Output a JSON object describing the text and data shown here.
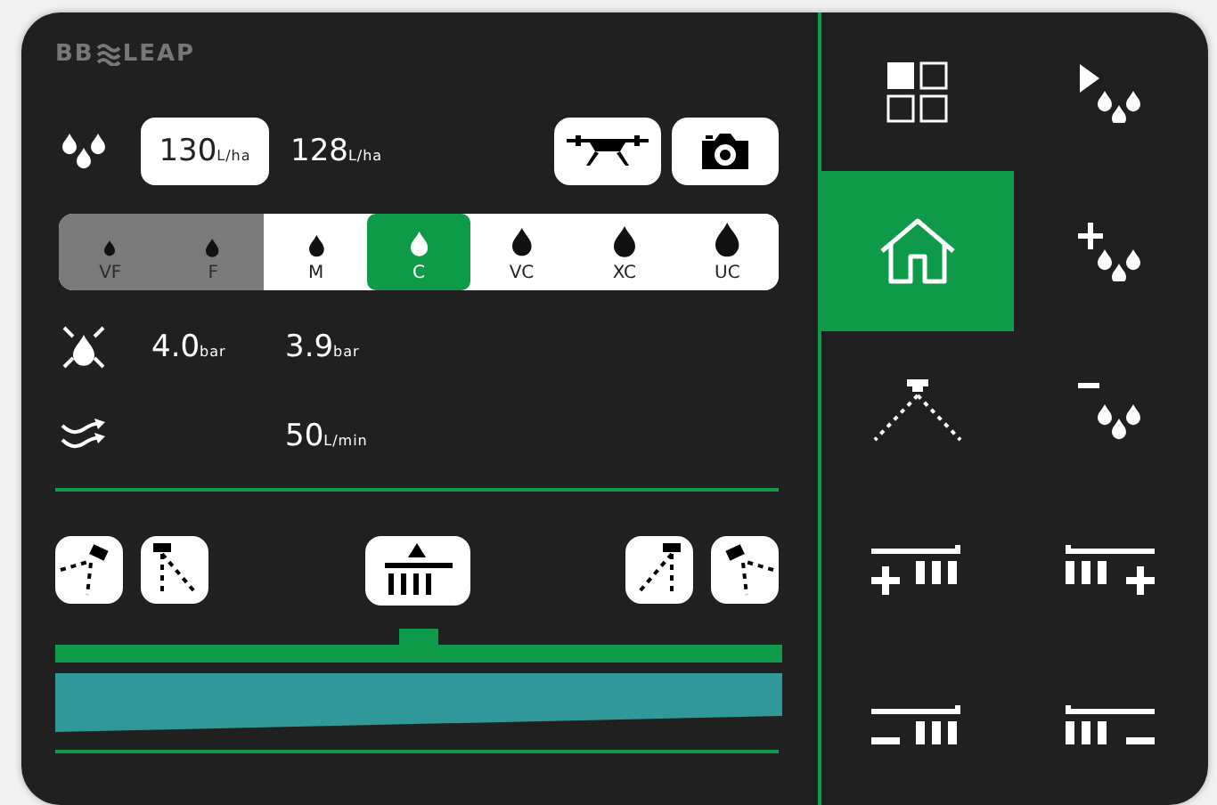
{
  "logo": {
    "left": "BB",
    "right": "LEAP"
  },
  "rate": {
    "set": "130",
    "set_unit": "L/ha",
    "actual": "128",
    "actual_unit": "L/ha"
  },
  "droplets": [
    {
      "label": "VF",
      "disabled": true,
      "selected": false
    },
    {
      "label": "F",
      "disabled": true,
      "selected": false
    },
    {
      "label": "M",
      "disabled": false,
      "selected": false
    },
    {
      "label": "C",
      "disabled": false,
      "selected": true
    },
    {
      "label": "VC",
      "disabled": false,
      "selected": false
    },
    {
      "label": "XC",
      "disabled": false,
      "selected": false
    },
    {
      "label": "UC",
      "disabled": false,
      "selected": false
    }
  ],
  "pressure": {
    "set": "4.0",
    "set_unit": "bar",
    "actual": "3.9",
    "actual_unit": "bar"
  },
  "flow": {
    "value": "50",
    "unit": "L/min"
  },
  "sections": [
    {
      "kind": "tilt-left"
    },
    {
      "kind": "raise-left"
    },
    {
      "kind": "boom"
    },
    {
      "kind": "raise-right"
    },
    {
      "kind": "tilt-right"
    }
  ],
  "menu": [
    {
      "kind": "grid",
      "selected": false
    },
    {
      "kind": "play-drops",
      "selected": false
    },
    {
      "kind": "home",
      "selected": true
    },
    {
      "kind": "plus-drops",
      "selected": false
    },
    {
      "kind": "nozzle",
      "selected": false
    },
    {
      "kind": "minus-drops",
      "selected": false
    },
    {
      "kind": "add-left",
      "selected": false
    },
    {
      "kind": "add-right",
      "selected": false
    },
    {
      "kind": "remove-left",
      "selected": false
    },
    {
      "kind": "remove-right",
      "selected": false
    }
  ]
}
